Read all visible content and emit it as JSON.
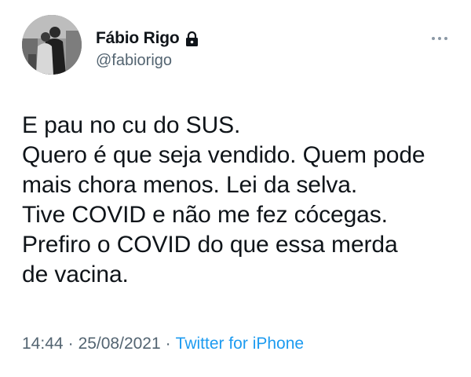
{
  "author": {
    "display_name": "Fábio Rigo",
    "handle": "@fabiorigo",
    "protected_icon": "lock-icon",
    "avatar": "profile-photo"
  },
  "more_menu_icon": "more-horizontal-icon",
  "tweet": {
    "lines": [
      "E pau no cu do SUS.",
      "Quero é que seja vendido. Quem pode",
      "mais chora menos. Lei da selva.",
      "Tive COVID e não me fez cócegas.",
      "Prefiro o COVID do que essa merda",
      "de vacina."
    ],
    "time": "14:44",
    "date": "25/08/2021",
    "separator": "·",
    "source": "Twitter for iPhone"
  },
  "colors": {
    "text": "#0f1419",
    "secondary": "#536471",
    "link": "#1d9bf0"
  }
}
